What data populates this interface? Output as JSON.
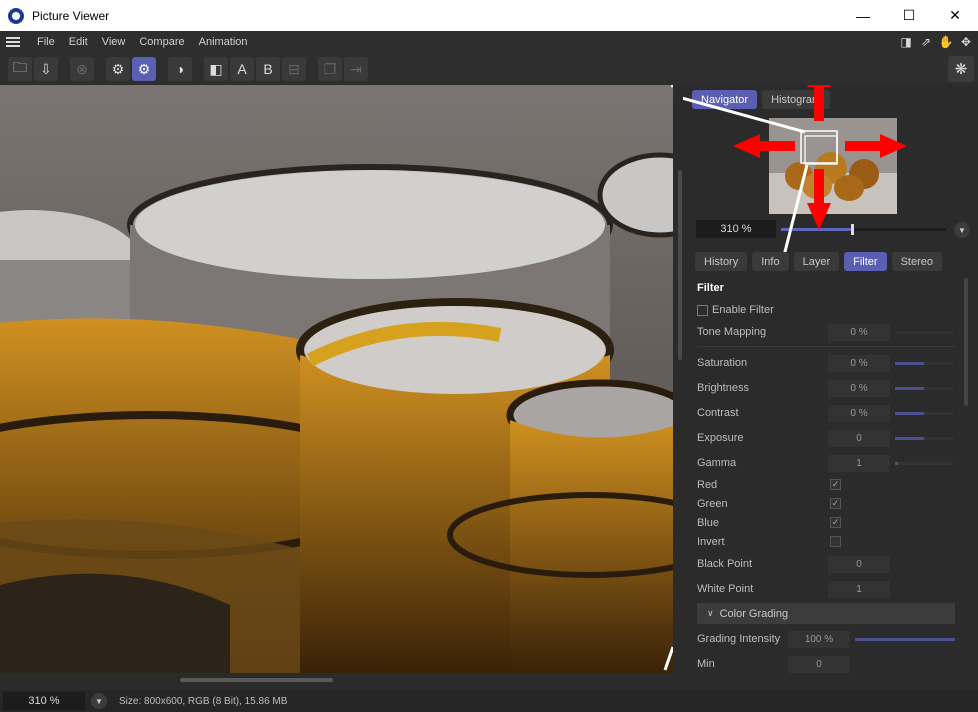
{
  "window": {
    "title": "Picture Viewer",
    "minimize": "—",
    "maximize": "☐",
    "close": "✕"
  },
  "menu": {
    "items": [
      "File",
      "Edit",
      "View",
      "Compare",
      "Animation"
    ]
  },
  "toolbar": {
    "text_a": "A",
    "text_b": "B"
  },
  "navigator": {
    "tabs": [
      "Navigator",
      "Histogram"
    ],
    "zoom": "310 %",
    "zoom_slider_fraction": 0.43
  },
  "panel_tabs": [
    "History",
    "Info",
    "Layer",
    "Filter",
    "Stereo"
  ],
  "filter": {
    "title": "Filter",
    "enable_label": "Enable Filter",
    "tone_mapping": {
      "label": "Tone Mapping",
      "value": "0 %"
    },
    "saturation": {
      "label": "Saturation",
      "value": "0 %",
      "level": 0.5
    },
    "brightness": {
      "label": "Brightness",
      "value": "0 %",
      "level": 0.5
    },
    "contrast": {
      "label": "Contrast",
      "value": "0 %",
      "level": 0.5
    },
    "exposure": {
      "label": "Exposure",
      "value": "0",
      "level": 0.5
    },
    "gamma": {
      "label": "Gamma",
      "value": "1",
      "level": 0.05
    },
    "red": {
      "label": "Red",
      "checked": true
    },
    "green": {
      "label": "Green",
      "checked": true
    },
    "blue": {
      "label": "Blue",
      "checked": true
    },
    "invert": {
      "label": "Invert",
      "checked": false
    },
    "black_point": {
      "label": "Black Point",
      "value": "0"
    },
    "white_point": {
      "label": "White Point",
      "value": "1"
    },
    "color_grading": {
      "header": "Color Grading",
      "intensity": {
        "label": "Grading Intensity",
        "value": "100 %",
        "level": 1.0
      },
      "min": {
        "label": "Min",
        "value": "0"
      }
    }
  },
  "status": {
    "zoom": "310 %",
    "size_info": "Size: 800x600, RGB (8 Bit), 15.86 MB"
  }
}
